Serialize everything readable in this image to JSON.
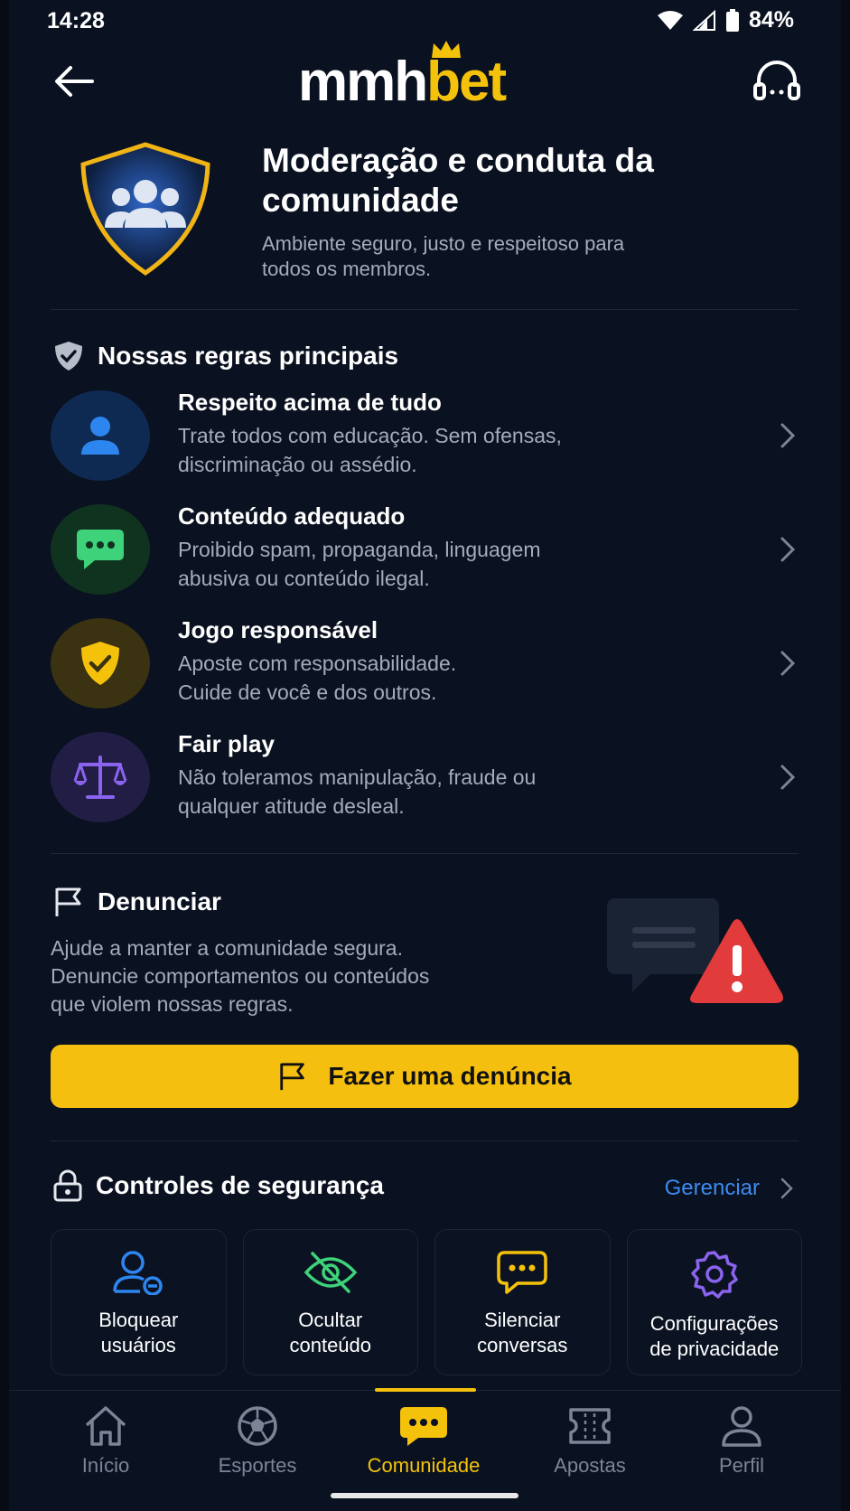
{
  "status_bar": {
    "time": "14:28",
    "battery": "84%"
  },
  "header": {
    "logo_part1": "mmh",
    "logo_part2": "bet"
  },
  "hero": {
    "title": "Moderação e conduta da comunidade",
    "subtitle": "Ambiente seguro, justo e respeitoso para todos os membros."
  },
  "rules": {
    "title": "Nossas regras principais",
    "items": [
      {
        "title": "Respeito acima de tudo",
        "desc": "Trate todos com educação. Sem ofensas,\ndiscriminação ou assédio.",
        "icon": "person-icon",
        "color": "#2d86f0"
      },
      {
        "title": "Conteúdo adequado",
        "desc": "Proibido spam, propaganda, linguagem\nabusiva ou conteúdo ilegal.",
        "icon": "chat-bubble-icon",
        "color": "#3ed27a"
      },
      {
        "title": "Jogo responsável",
        "desc": "Aposte com responsabilidade.\nCuide de você e dos outros.",
        "icon": "shield-check-icon",
        "color": "#f5c20b"
      },
      {
        "title": "Fair play",
        "desc": "Não toleramos manipulação, fraude ou\nqualquer atitude desleal.",
        "icon": "scales-icon",
        "color": "#8a63ef"
      }
    ]
  },
  "report": {
    "title": "Denunciar",
    "desc": "Ajude a manter a comunidade segura.\nDenuncie comportamentos ou conteúdos\nque violem nossas regras.",
    "button_label": "Fazer uma denúncia"
  },
  "security": {
    "title": "Controles de segurança",
    "manage_label": "Gerenciar",
    "cards": [
      {
        "label": "Bloquear\nusuários",
        "icon": "block-user-icon",
        "color": "#2d86f0"
      },
      {
        "label": "Ocultar\nconteúdo",
        "icon": "eye-off-icon",
        "color": "#3ed27a"
      },
      {
        "label": "Silenciar\nconversas",
        "icon": "chat-mute-icon",
        "color": "#f5c20b"
      },
      {
        "label": "Configurações\nde privacidade",
        "icon": "gear-icon",
        "color": "#8a63ef"
      }
    ]
  },
  "nav": {
    "items": [
      {
        "label": "Início",
        "icon": "home-icon"
      },
      {
        "label": "Esportes",
        "icon": "soccer-ball-icon"
      },
      {
        "label": "Comunidade",
        "icon": "chat-bubble-icon",
        "active": true
      },
      {
        "label": "Apostas",
        "icon": "ticket-icon"
      },
      {
        "label": "Perfil",
        "icon": "person-icon"
      }
    ]
  }
}
